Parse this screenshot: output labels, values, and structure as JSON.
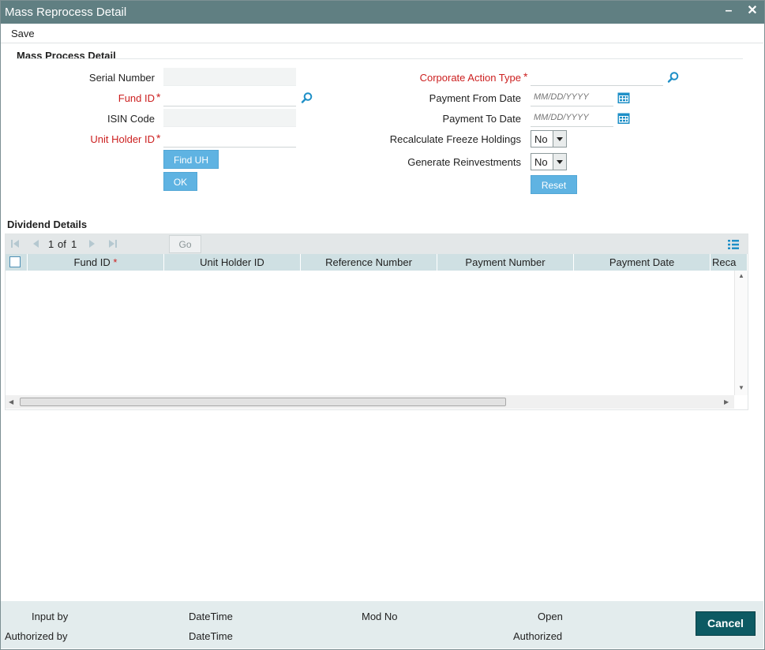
{
  "window": {
    "title": "Mass Reprocess Detail",
    "minimize": "–",
    "close": "✕"
  },
  "menu": {
    "save": "Save"
  },
  "mass_process": {
    "section_title": "Mass Process Detail",
    "serial_number": {
      "label": "Serial Number",
      "value": ""
    },
    "fund_id": {
      "label": "Fund ID",
      "value": ""
    },
    "isin_code": {
      "label": "ISIN Code",
      "value": ""
    },
    "unit_holder_id": {
      "label": "Unit Holder ID",
      "value": ""
    },
    "find_uh_button": "Find UH",
    "ok_button": "OK",
    "corporate_action_type": {
      "label": "Corporate Action Type",
      "value": ""
    },
    "payment_from_date": {
      "label": "Payment From Date",
      "placeholder": "MM/DD/YYYY"
    },
    "payment_to_date": {
      "label": "Payment To Date",
      "placeholder": "MM/DD/YYYY"
    },
    "recalculate_freeze_holdings": {
      "label": "Recalculate Freeze Holdings",
      "value": "No"
    },
    "generate_reinvestments": {
      "label": "Generate Reinvestments",
      "value": "No"
    },
    "reset_button": "Reset",
    "required_mark": "*"
  },
  "dividend": {
    "section_title": "Dividend Details",
    "page_current": "1",
    "page_of": "of",
    "page_total": "1",
    "go_button": "Go",
    "columns": [
      "Fund ID",
      "Unit Holder ID",
      "Reference Number",
      "Payment Number",
      "Payment Date",
      "Reca"
    ],
    "required_mark": "*",
    "rows": []
  },
  "footer": {
    "input_by": "Input by",
    "authorized_by": "Authorized by",
    "datetime_1": "DateTime",
    "datetime_2": "DateTime",
    "mod_no": "Mod No",
    "open": "Open",
    "authorized": "Authorized",
    "cancel_button": "Cancel"
  },
  "colors": {
    "titlebar": "#607f82",
    "required": "#cc1f1f",
    "button": "#5fb3e2",
    "cancel": "#0d5a63",
    "grid_header": "#cfe0e3",
    "footer": "#e3eced",
    "icon": "#1e8fc7"
  }
}
